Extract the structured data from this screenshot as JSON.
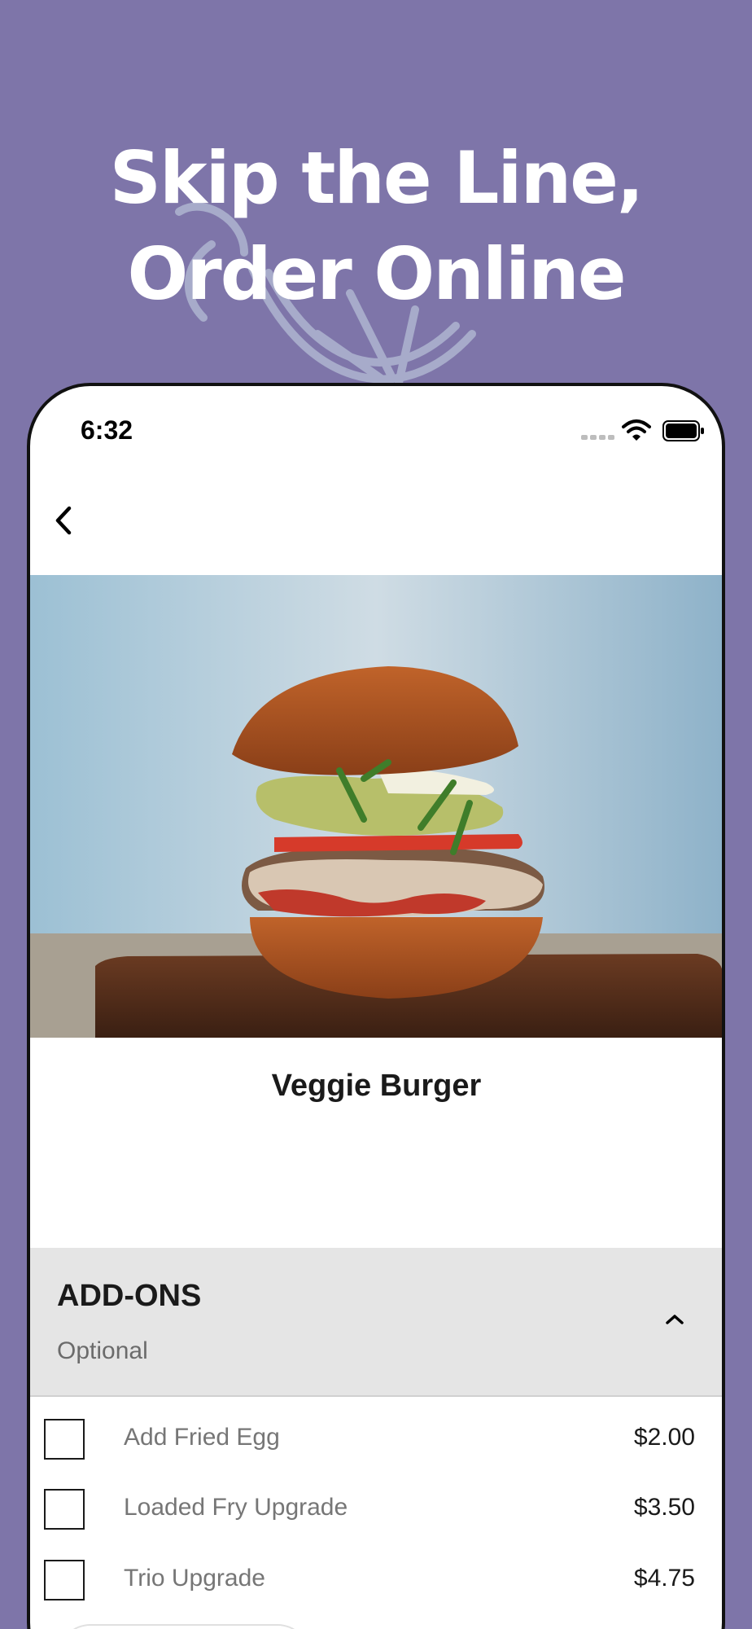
{
  "marketing": {
    "headline_line1": "Skip the Line,",
    "headline_line2": "Order Online"
  },
  "status_bar": {
    "time": "6:32"
  },
  "product": {
    "name": "Veggie Burger"
  },
  "addons": {
    "title": "ADD-ONS",
    "subtitle": "Optional",
    "items": [
      {
        "label": "Add Fried Egg",
        "price": "$2.00"
      },
      {
        "label": "Loaded Fry Upgrade",
        "price": "$3.50"
      },
      {
        "label": "Trio Upgrade",
        "price": "$4.75"
      }
    ]
  },
  "colors": {
    "background": "#7e75a9",
    "panel": "#e5e5e5",
    "text": "#1a1a1a",
    "muted": "#767676"
  }
}
